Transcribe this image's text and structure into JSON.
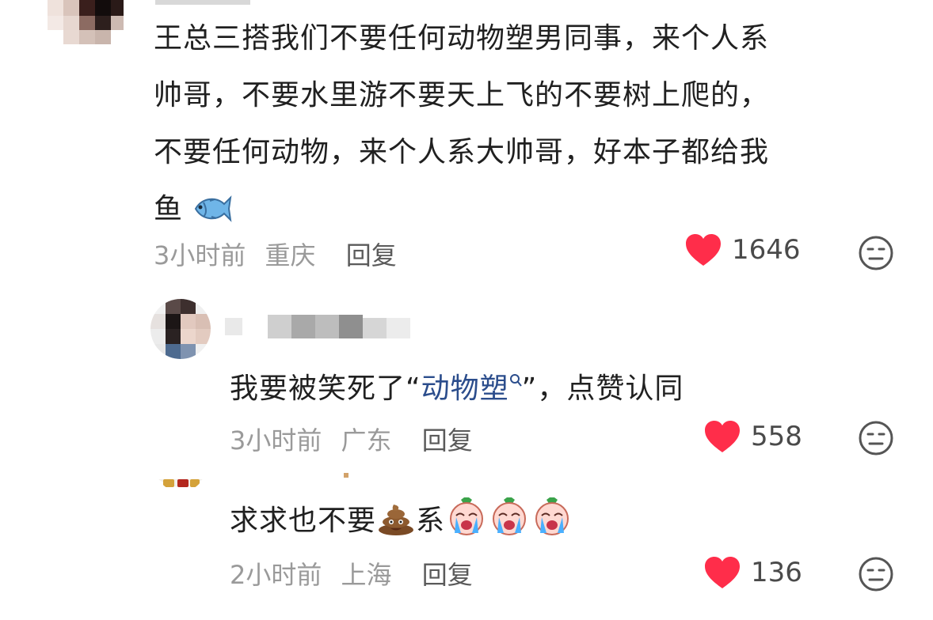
{
  "comments": [
    {
      "text_lines": [
        "王总三搭我们不要任何动物塑男同事，来个人系",
        "帅哥，不要水里游不要天上飞的不要树上爬的，",
        "不要任何动物，来个人系大帅哥，好本子都给我",
        "鱼"
      ],
      "time": "3小时前",
      "location": "重庆",
      "reply_label": "回复",
      "likes": "1646"
    },
    {
      "text_prefix": "我要被笑死了“",
      "link_word": "动物塑",
      "text_suffix": "”，点赞认同",
      "time": "3小时前",
      "location": "广东",
      "reply_label": "回复",
      "likes": "558"
    },
    {
      "text_prefix": "求求也不要",
      "text_middle": "系",
      "time": "2小时前",
      "location": "上海",
      "reply_label": "回复",
      "likes": "136"
    }
  ],
  "colors": {
    "heart": "#ff2d4a",
    "link": "#2b4d8c",
    "meta": "#9a9a9a"
  },
  "icons": [
    "fish-emoji",
    "poop-emoji",
    "crying-emoji",
    "heart-icon",
    "meh-face-icon",
    "search-icon"
  ]
}
